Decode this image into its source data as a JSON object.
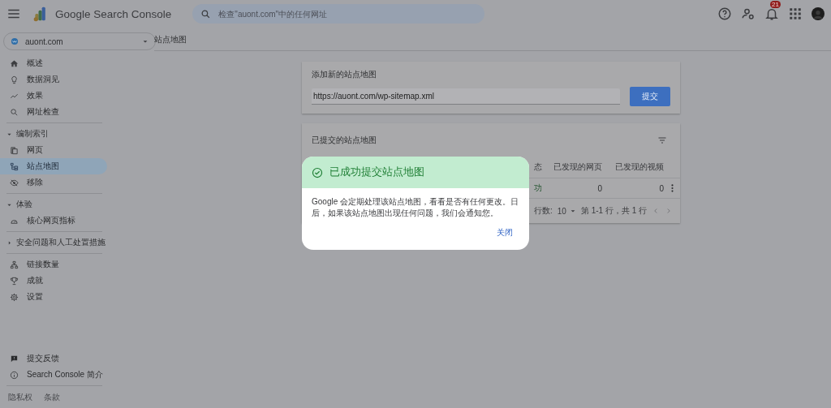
{
  "header": {
    "app_name": "Google Search Console",
    "search": {
      "placeholder": "检查\"auont.com\"中的任何网址"
    },
    "notifications_badge": "21"
  },
  "property_selector": {
    "label": "auont.com"
  },
  "sidebar": {
    "groups": [
      {
        "items": [
          {
            "label": "概述",
            "selected": false
          },
          {
            "label": "数据洞见",
            "selected": false
          },
          {
            "label": "效果",
            "selected": false
          },
          {
            "label": "网址检查",
            "selected": false
          }
        ]
      },
      {
        "heading": "编制索引",
        "expanded": true,
        "items": [
          {
            "label": "网页",
            "selected": false
          },
          {
            "label": "站点地图",
            "selected": true
          },
          {
            "label": "移除",
            "selected": false
          }
        ]
      },
      {
        "heading": "体验",
        "expanded": true,
        "items": [
          {
            "label": "核心网页指标",
            "selected": false
          }
        ]
      },
      {
        "heading": "安全问题和人工处置措施",
        "expanded": false
      },
      {
        "items": [
          {
            "label": "链接数量",
            "selected": false
          },
          {
            "label": "成就",
            "selected": false
          },
          {
            "label": "设置",
            "selected": false
          }
        ]
      }
    ],
    "footer_items": [
      "提交反馈",
      "Search Console 简介"
    ],
    "legal_links": [
      "隐私权",
      "条款"
    ]
  },
  "page_title": "站点地图",
  "add_sitemap": {
    "title": "添加新的站点地图",
    "url_value": "https://auont.com/wp-sitemap.xml",
    "submit": "提交"
  },
  "submitted_sitemaps": {
    "title": "已提交的站点地图",
    "columns": [
      "态",
      "已发现的网页",
      "已发现的视频"
    ],
    "rows": [
      {
        "cells": [
          "功",
          "0",
          "0"
        ]
      }
    ],
    "footer": {
      "rows_per_page_label": "行数:",
      "rows_per_page": "10",
      "range": "第 1-1 行，共 1 行"
    }
  },
  "dialog": {
    "title": "已成功提交站点地图",
    "body": "Google 会定期处理该站点地图，看看是否有任何更改。日后，如果该站点地图出现任何问题，我们会通知您。",
    "close": "关闭"
  }
}
